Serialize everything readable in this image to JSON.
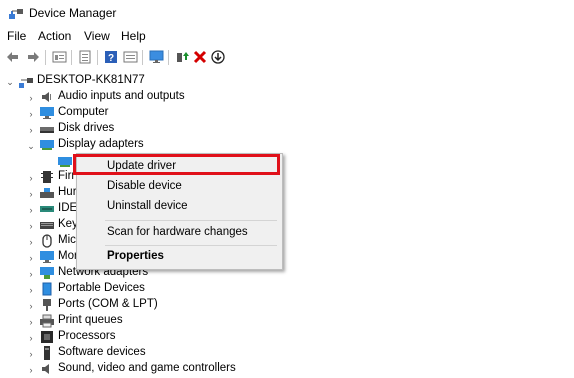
{
  "window": {
    "title": "Device Manager"
  },
  "menu": [
    "File",
    "Action",
    "View",
    "Help"
  ],
  "toolbar": {
    "buttons": [
      "back-icon",
      "forward-icon",
      "properties-view-icon",
      "details-icon",
      "help-icon",
      "show-view-icon",
      "monitor-icon",
      "enable-device-icon",
      "uninstall-x-icon",
      "update-driver-icon"
    ],
    "colors": {
      "delete": "#d40000",
      "enable": "#1a8f2e"
    }
  },
  "tree": {
    "root": "DESKTOP-KK81N77",
    "categories": [
      "Audio inputs and outputs",
      "Computer",
      "Disk drives",
      "Display adapters",
      "",
      "Firmware",
      "Human Interface Devices",
      "IDE ATA/ATAPI controllers",
      "Keyboards",
      "Mice and other pointing devices",
      "Monitors",
      "Network adapters",
      "Portable Devices",
      "Ports (COM & LPT)",
      "Print queues",
      "Processors",
      "Software devices",
      "Sound, video and game controllers"
    ],
    "partial": [
      "Firn",
      "Hur",
      "IDE",
      "Key",
      "Mic",
      "Mor"
    ]
  },
  "context_menu": {
    "items": [
      "Update driver",
      "Disable device",
      "Uninstall device",
      "Scan for hardware changes",
      "Properties"
    ],
    "highlight_color": "#e0101a"
  }
}
